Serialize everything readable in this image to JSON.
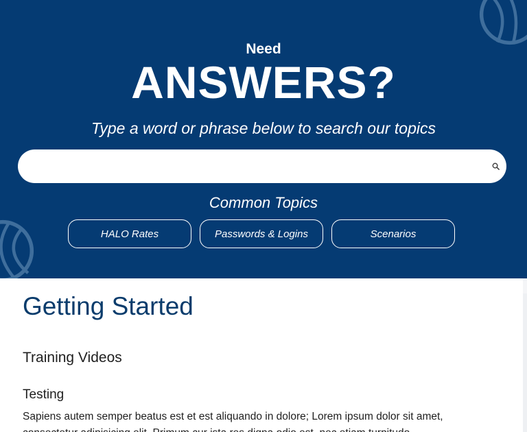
{
  "hero": {
    "need": "Need",
    "headline": "ANSWERS?",
    "tagline": "Type a word or phrase below to search our topics",
    "background": "#053b73"
  },
  "search": {
    "value": "",
    "placeholder": "",
    "icon": "search-icon"
  },
  "common_topics": {
    "title": "Common Topics",
    "items": [
      {
        "label": "HALO Rates"
      },
      {
        "label": "Passwords & Logins"
      },
      {
        "label": "Scenarios"
      }
    ]
  },
  "content": {
    "heading": "Getting Started",
    "section": "Training Videos",
    "subsection": "Testing",
    "paragraph": "Sapiens autem semper beatus est et est aliquando in dolore; Lorem ipsum dolor sit amet, consectetur adipisicing elit. Primum cur ista res digna odio est, nec etiam turpitudo."
  },
  "colors": {
    "brand_navy": "#053b73",
    "heading_blue": "#0a3c6c",
    "text": "#1f1f1f"
  }
}
